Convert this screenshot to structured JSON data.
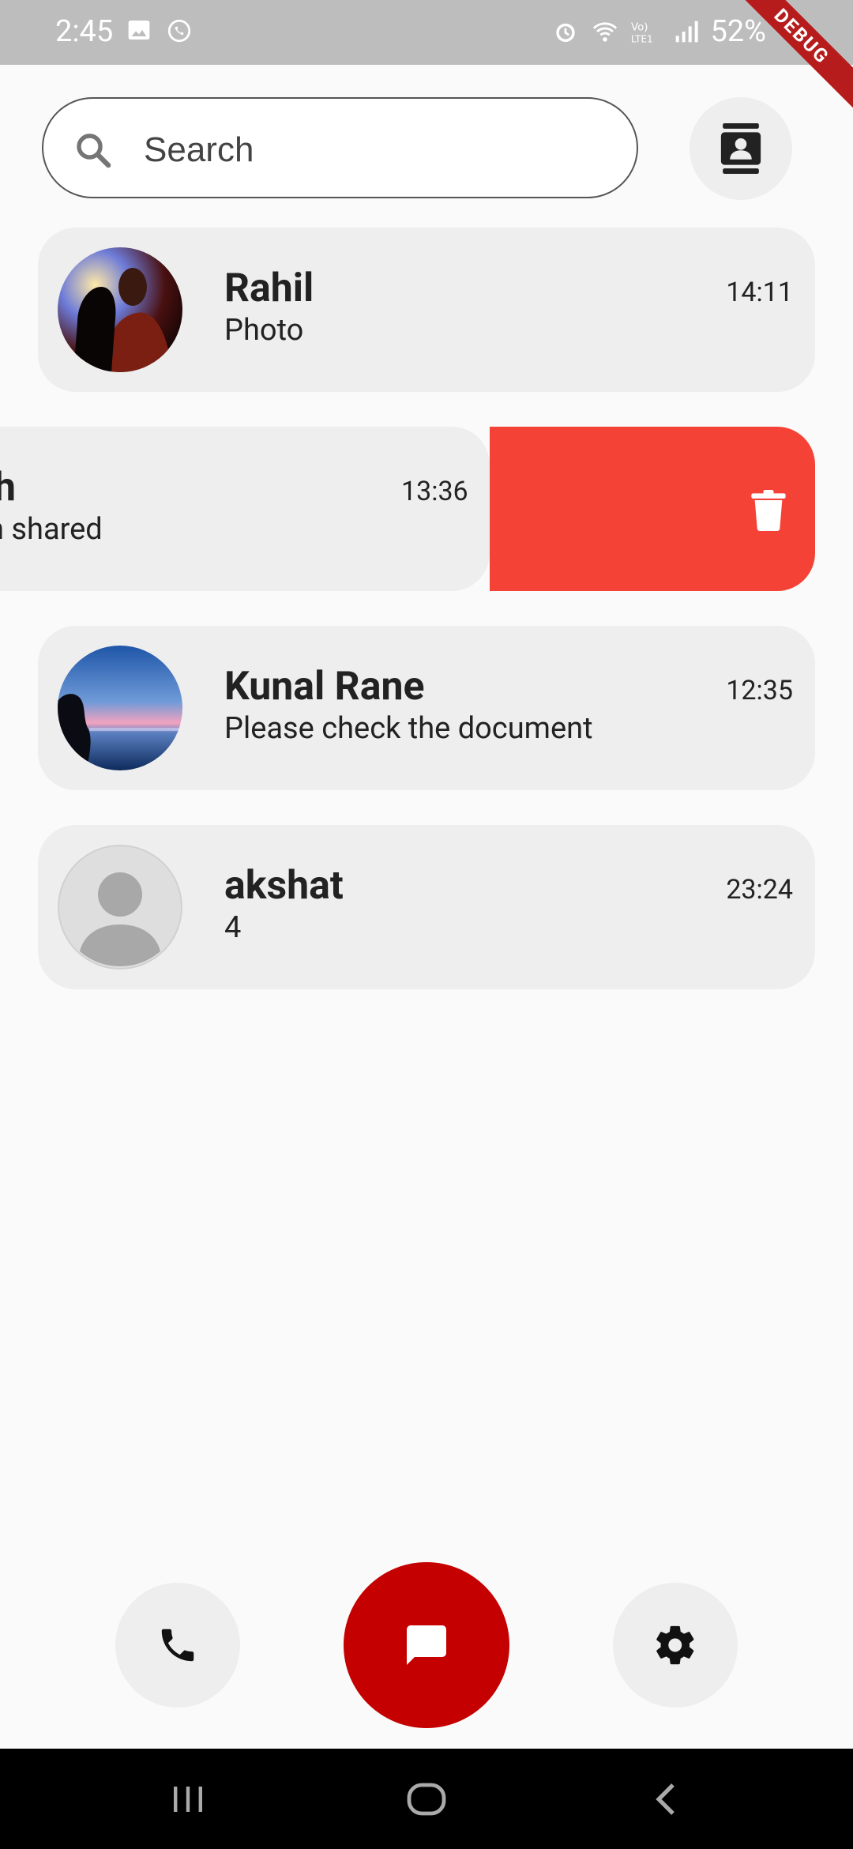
{
  "status_bar": {
    "time": "2:45",
    "battery": "52%",
    "debug_label": "DEBUG"
  },
  "search": {
    "placeholder": "Search"
  },
  "chats": [
    {
      "name": "Rahil",
      "message": "Photo",
      "time": "14:11"
    },
    {
      "name": "h",
      "message": "ation shared",
      "time": "13:36"
    },
    {
      "name": "Kunal Rane",
      "message": "Please check the document",
      "time": "12:35"
    },
    {
      "name": "akshat",
      "message": "4",
      "time": "23:24"
    }
  ],
  "colors": {
    "accent": "#c40000",
    "delete": "#f44336",
    "card": "#eeeeee",
    "background": "#fafafa"
  },
  "icons": {
    "contacts": "contacts-icon",
    "search": "search-icon",
    "delete": "trash-icon",
    "call": "phone-icon",
    "chat": "chat-icon",
    "settings": "gear-icon"
  }
}
